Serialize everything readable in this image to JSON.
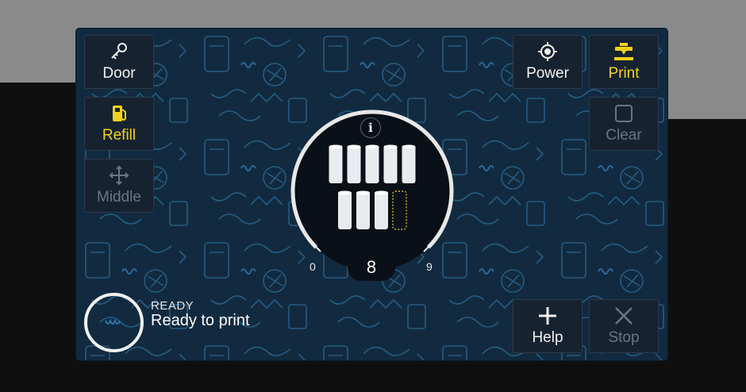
{
  "buttons": {
    "door": "Door",
    "refill": "Refill",
    "middle": "Middle",
    "power": "Power",
    "print": "Print",
    "clear": "Clear",
    "help": "Help",
    "stop": "Stop"
  },
  "gauge": {
    "min_label": "0",
    "max_label": "9",
    "count": "8",
    "filled_slots": 8,
    "total_slots": 9,
    "info_label": "i"
  },
  "status": {
    "state": "READY",
    "message": "Ready to print"
  },
  "colors": {
    "accent_yellow": "#f1d21b",
    "screen_bg": "#122a3f",
    "pattern": "#2c6a96",
    "disabled_text": "#6a7582"
  },
  "icons": {
    "door": "key-icon",
    "refill": "fuel-pump-icon",
    "middle": "move-arrows-icon",
    "power": "power-target-icon",
    "print": "printer-nozzle-icon",
    "clear": "square-outline-icon",
    "help": "plus-icon",
    "stop": "x-icon",
    "status": "wave-icon"
  }
}
